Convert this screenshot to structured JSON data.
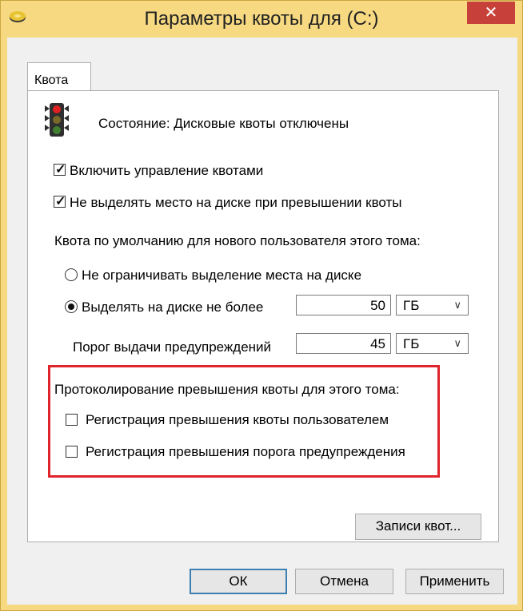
{
  "window": {
    "title": "Параметры квоты для  (C:)",
    "close_label": "✕"
  },
  "tabs": [
    {
      "label": "Квота"
    }
  ],
  "status": {
    "text": "Состояние:  Дисковые квоты отключены"
  },
  "options": {
    "enable_quota": {
      "label": "Включить управление квотами",
      "checked": true
    },
    "deny_space": {
      "label": "Не выделять место на диске при превышении квоты",
      "checked": true
    }
  },
  "default_quota": {
    "heading": "Квота по умолчанию для нового пользователя этого тома:",
    "no_limit": {
      "label": "Не ограничивать выделение места на диске",
      "selected": false
    },
    "limit": {
      "label": "Выделять на диске не более",
      "selected": true,
      "value": "50",
      "unit": "ГБ"
    },
    "warning": {
      "label": "Порог выдачи предупреждений",
      "value": "45",
      "unit": "ГБ"
    }
  },
  "logging": {
    "heading": "Протоколирование превышения квоты для этого тома:",
    "log_quota": {
      "label": "Регистрация превышения квоты пользователем",
      "checked": false
    },
    "log_warning": {
      "label": "Регистрация превышения порога предупреждения",
      "checked": false
    }
  },
  "buttons": {
    "quota_entries": "Записи квот...",
    "ok": "ОК",
    "cancel": "Отмена",
    "apply": "Применить"
  },
  "colors": {
    "titlebar": "#f6d981",
    "close_button": "#c7413a",
    "highlight": "#e0242c"
  }
}
